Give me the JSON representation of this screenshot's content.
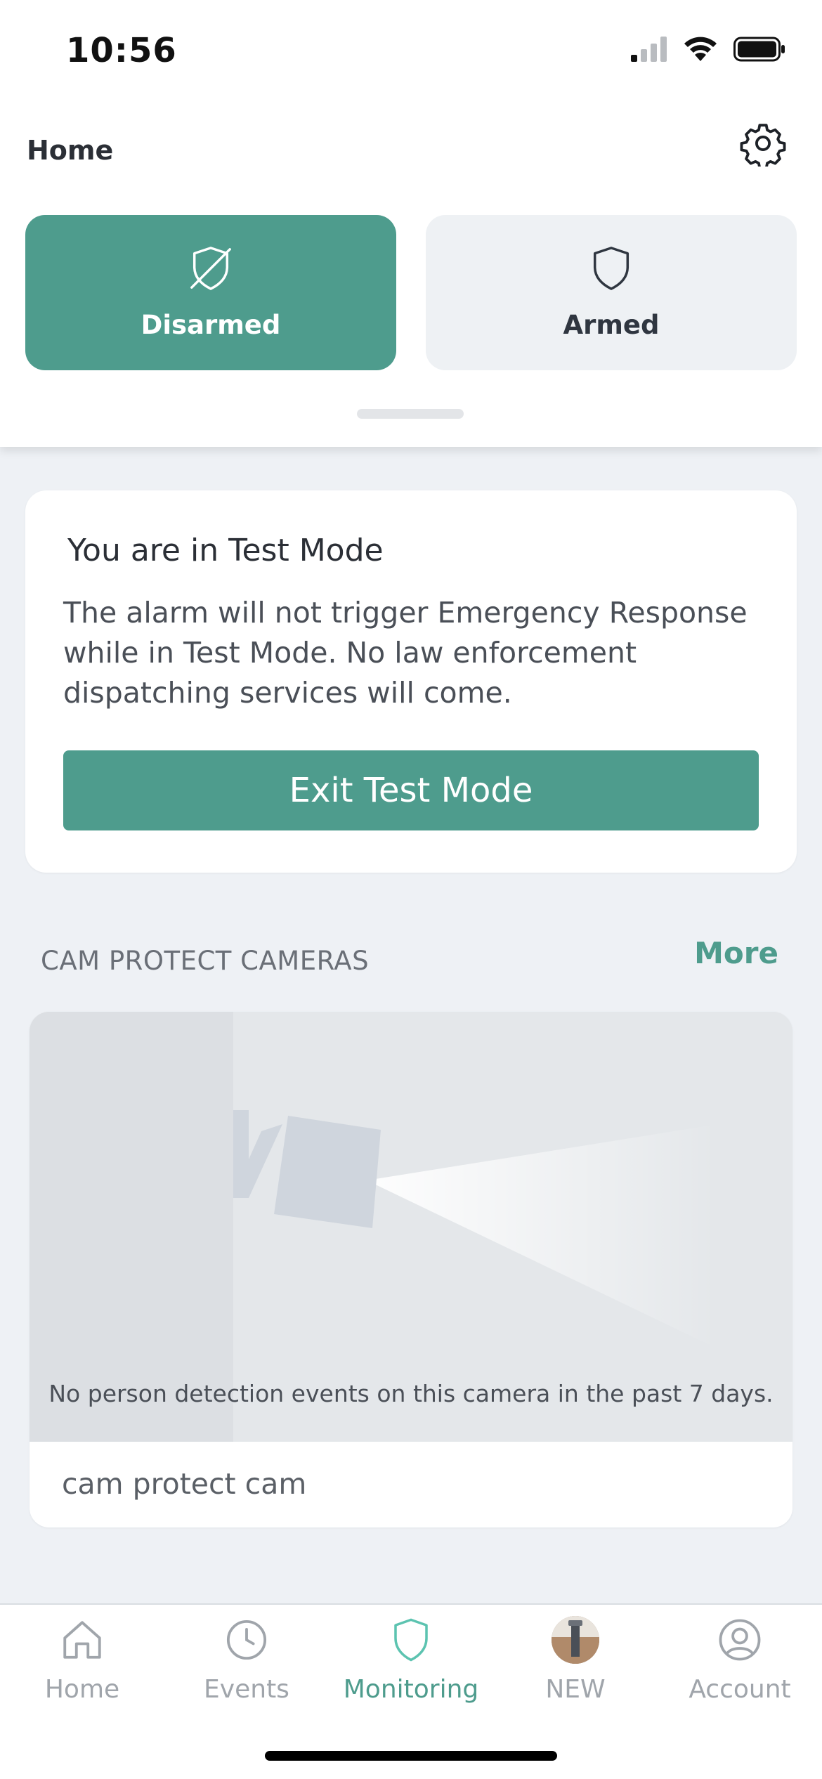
{
  "status_bar": {
    "time": "10:56",
    "icons": [
      "cellular-signal-icon",
      "wifi-icon",
      "battery-icon"
    ]
  },
  "header": {
    "title": "Home",
    "settings_icon": "gear-icon"
  },
  "arming_modes": [
    {
      "label": "Disarmed",
      "icon": "shield-slash-icon",
      "selected": true
    },
    {
      "label": "Armed",
      "icon": "shield-icon",
      "selected": false
    }
  ],
  "test_mode_card": {
    "title": "You are in Test Mode",
    "body": "The alarm will not trigger Emergency Response while in Test Mode. No law enforcement dispatching services will come.",
    "button_label": "Exit Test Mode"
  },
  "cameras_section": {
    "title": "CAM PROTECT CAMERAS",
    "more_label": "More",
    "cameras": [
      {
        "caption": "No person detection events on this camera in the past 7 days.",
        "name": "cam protect cam"
      }
    ]
  },
  "tab_bar": {
    "tabs": [
      {
        "label": "Home",
        "icon": "house-icon",
        "active": false
      },
      {
        "label": "Events",
        "icon": "clock-icon",
        "active": false
      },
      {
        "label": "Monitoring",
        "icon": "shield-icon",
        "active": true
      },
      {
        "label": "NEW",
        "icon": "product-thumbnail",
        "active": false
      },
      {
        "label": "Account",
        "icon": "person-circle-icon",
        "active": false
      }
    ]
  },
  "colors": {
    "accent": "#4e9c8d",
    "background": "#eef1f5",
    "card": "#ffffff",
    "inactive_tab": "#a0a5ab"
  }
}
